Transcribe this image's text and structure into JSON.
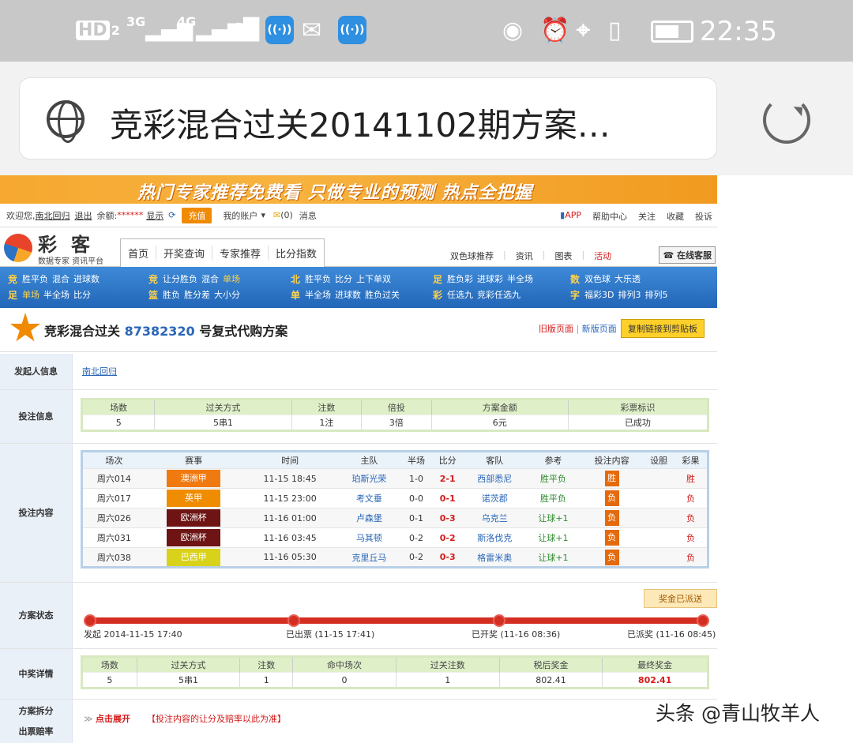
{
  "status_bar": {
    "hd": "HD",
    "sim": "2",
    "net1": "3G",
    "net2": "4G",
    "time": "22:35"
  },
  "browser": {
    "url_title": "竞彩混合过关20141102期方案…"
  },
  "banner": {
    "text": "热门专家推荐免费看 只做专业的预测 热点全把握"
  },
  "topbar": {
    "welcome": "欢迎您,",
    "user": "南北回归",
    "logout": "退出",
    "balance_label": "余额:",
    "balance_mask": "******",
    "show": "显示",
    "recharge": "充值",
    "account": "我的账户",
    "mail_count": "(0)",
    "message": "消息",
    "right": [
      "APP",
      "帮助中心",
      "关注",
      "收藏",
      "投诉"
    ]
  },
  "logo": {
    "name": "彩客",
    "sub": "数据专家 资讯平台"
  },
  "nav": [
    "首页",
    "开奖查询",
    "专家推荐",
    "比分指数"
  ],
  "subnav": [
    "双色球推荐",
    "资讯",
    "图表",
    "活动"
  ],
  "kefu": "在线客服",
  "lottery_nav": [
    {
      "big": [
        "竞",
        "足"
      ],
      "l1": [
        [
          "胜平负",
          0
        ],
        [
          "混合",
          0
        ],
        [
          "进球数",
          0
        ]
      ],
      "l2": [
        [
          "单场",
          1
        ],
        [
          "半全场",
          0
        ],
        [
          "比分",
          0
        ]
      ]
    },
    {
      "big": [
        "竞",
        "篮"
      ],
      "l1": [
        [
          "让分胜负",
          0
        ],
        [
          "混合",
          0
        ],
        [
          "单场",
          1
        ]
      ],
      "l2": [
        [
          "胜负",
          0
        ],
        [
          "胜分差",
          0
        ],
        [
          "大小分",
          0
        ]
      ]
    },
    {
      "big": [
        "北",
        "单"
      ],
      "l1": [
        [
          "胜平负",
          0
        ],
        [
          "比分",
          0
        ],
        [
          "上下单双",
          0
        ]
      ],
      "l2": [
        [
          "半全场",
          0
        ],
        [
          "进球数",
          0
        ],
        [
          "胜负过关",
          0
        ]
      ]
    },
    {
      "big": [
        "足",
        "彩"
      ],
      "l1": [
        [
          "胜负彩",
          0
        ],
        [
          "进球彩",
          0
        ],
        [
          "半全场",
          0
        ]
      ],
      "l2": [
        [
          "任选九",
          0
        ],
        [
          "竞彩任选九",
          0
        ]
      ]
    },
    {
      "big": [
        "数",
        "字"
      ],
      "l1": [
        [
          "双色球",
          0
        ],
        [
          "大乐透",
          0
        ]
      ],
      "l2": [
        [
          "福彩3D",
          0
        ],
        [
          "排列3",
          0
        ],
        [
          "排列5",
          0
        ]
      ]
    }
  ],
  "plan_title": {
    "pre": "竞彩混合过关",
    "num": "87382320",
    "post": "号复式代购方案",
    "old": "旧版页面",
    "sep": "|",
    "new": "新版页面",
    "copy": "复制链接到剪贴板"
  },
  "labels": {
    "sponsor": "发起人信息",
    "bet_info": "投注信息",
    "bet_content": "投注内容",
    "status": "方案状态",
    "prize_detail": "中奖详情",
    "split1": "方案拆分",
    "split2": "出票赔率"
  },
  "sponsor_name": "南北回归",
  "bet_info": {
    "headers": [
      "场数",
      "过关方式",
      "注数",
      "倍投",
      "方案金额",
      "彩票标识"
    ],
    "values": [
      "5",
      "5串1",
      "1注",
      "3倍",
      "6元",
      "已成功"
    ]
  },
  "matches": {
    "headers": [
      "场次",
      "赛事",
      "时间",
      "主队",
      "半场",
      "比分",
      "客队",
      "参考",
      "投注内容",
      "设胆",
      "彩果"
    ],
    "rows": [
      {
        "no": "周六014",
        "league": "澳洲甲",
        "color": "#f07a10",
        "time": "11-15 18:45",
        "home": "珀斯光荣",
        "half": "1-0",
        "score": "2-1",
        "away": "西部悉尼",
        "ref": "胜平负",
        "pick": "胜",
        "result": "胜"
      },
      {
        "no": "周六017",
        "league": "英甲",
        "color": "#f08c00",
        "time": "11-15 23:00",
        "home": "考文垂",
        "half": "0-0",
        "score": "0-1",
        "away": "诺茨郡",
        "ref": "胜平负",
        "pick": "负",
        "result": "负"
      },
      {
        "no": "周六026",
        "league": "欧洲杯",
        "color": "#6e1414",
        "time": "11-16 01:00",
        "home": "卢森堡",
        "half": "0-1",
        "score": "0-3",
        "away": "乌克兰",
        "ref": "让球+1",
        "pick": "负",
        "result": "负"
      },
      {
        "no": "周六031",
        "league": "欧洲杯",
        "color": "#6e1414",
        "time": "11-16 03:45",
        "home": "马其顿",
        "half": "0-2",
        "score": "0-2",
        "away": "斯洛伐克",
        "ref": "让球+1",
        "pick": "负",
        "result": "负"
      },
      {
        "no": "周六038",
        "league": "巴西甲",
        "color": "#d8d21a",
        "time": "11-16 05:30",
        "home": "克里丘马",
        "half": "0-2",
        "score": "0-3",
        "away": "格雷米奥",
        "ref": "让球+1",
        "pick": "负",
        "result": "负"
      }
    ]
  },
  "status": {
    "badge": "奖金已派送",
    "steps": [
      "发起 2014-11-15 17:40",
      "已出票 (11-15 17:41)",
      "已开奖 (11-16 08:36)",
      "已派奖 (11-16 08:45)"
    ]
  },
  "prize": {
    "headers": [
      "场数",
      "过关方式",
      "注数",
      "命中场次",
      "过关注数",
      "税后奖金",
      "最终奖金"
    ],
    "values": [
      "5",
      "5串1",
      "1",
      "0",
      "1",
      "802.41",
      "802.41"
    ]
  },
  "split": {
    "expand": "点击展开",
    "note": "【投注内容的让分及赔率以此为准】"
  },
  "watermark": "头条 @青山牧羊人"
}
